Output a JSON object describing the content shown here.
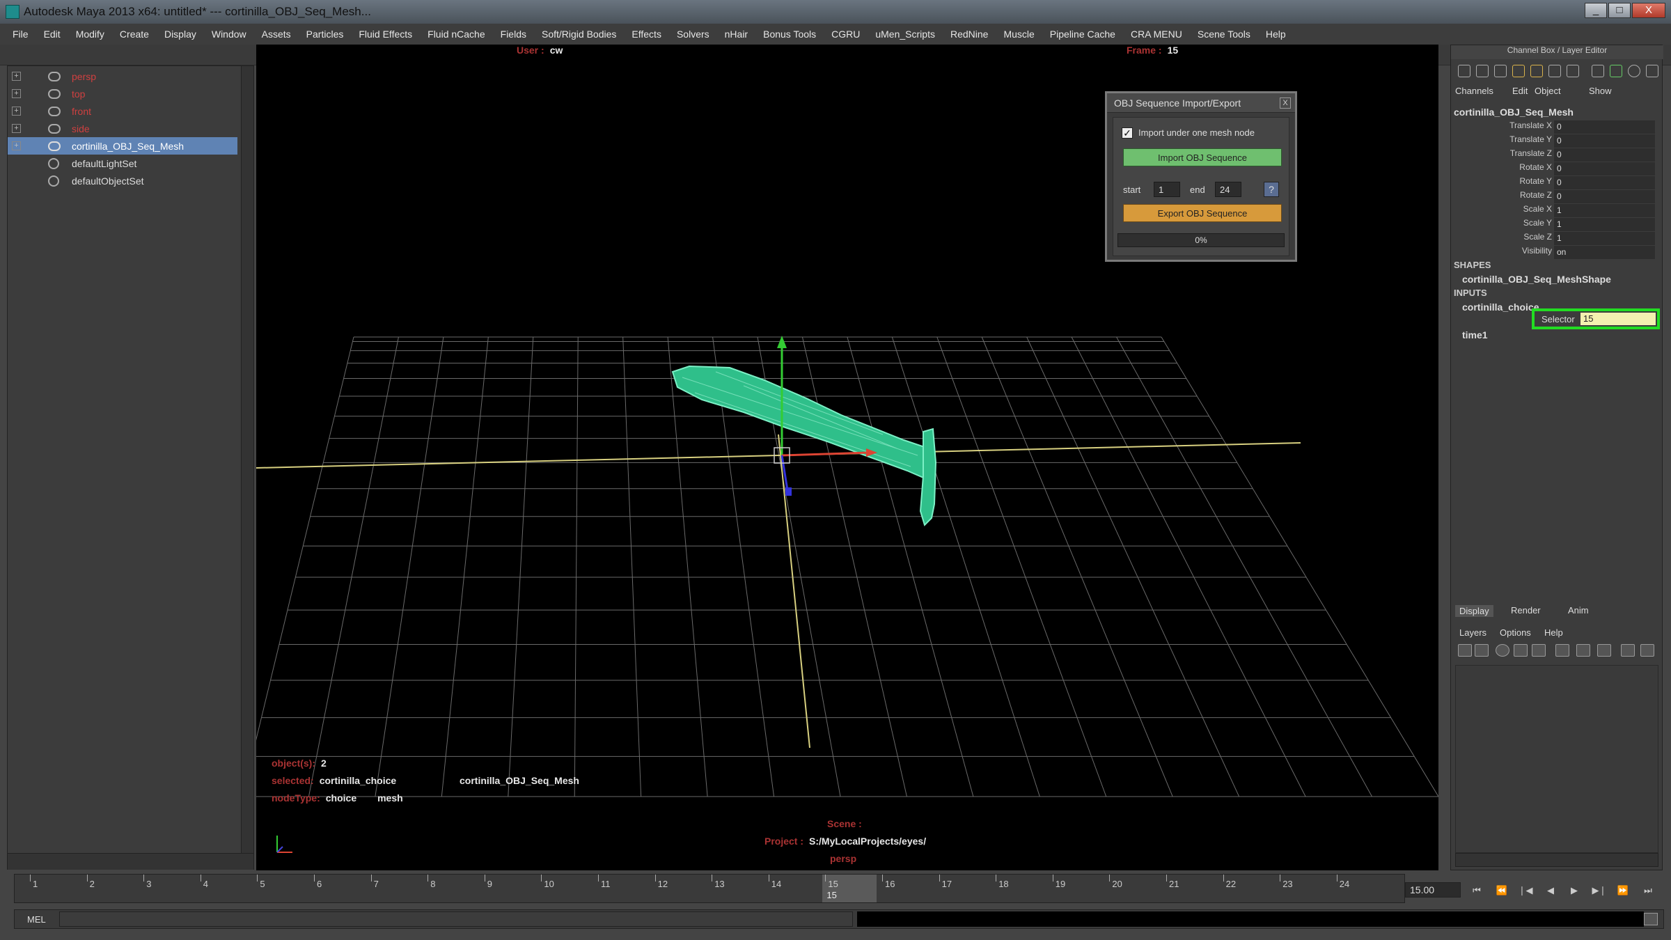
{
  "window": {
    "title": "Autodesk Maya 2013 x64: untitled*   ---   cortinilla_OBJ_Seq_Mesh...",
    "buttons": [
      "_",
      "□",
      "X"
    ]
  },
  "menubar": [
    "File",
    "Edit",
    "Modify",
    "Create",
    "Display",
    "Window",
    "Assets",
    "Particles",
    "Fluid Effects",
    "Fluid nCache",
    "Fields",
    "Soft/Rigid Bodies",
    "Effects",
    "Solvers",
    "nHair",
    "Bonus Tools",
    "CGRU",
    "uMen_Scripts",
    "RedNine",
    "Muscle",
    "Pipeline Cache",
    "CRA MENU",
    "Scene Tools",
    "Help"
  ],
  "outliner": {
    "items": [
      {
        "label": "persp",
        "type": "camera",
        "expand": "+"
      },
      {
        "label": "top",
        "type": "camera",
        "expand": "+"
      },
      {
        "label": "front",
        "type": "camera",
        "expand": "+"
      },
      {
        "label": "side",
        "type": "camera",
        "expand": "+"
      },
      {
        "label": "cortinilla_OBJ_Seq_Mesh",
        "type": "mesh",
        "expand": "+",
        "selected": true
      },
      {
        "label": "defaultLightSet",
        "type": "set",
        "expand": ""
      },
      {
        "label": "defaultObjectSet",
        "type": "set",
        "expand": ""
      }
    ]
  },
  "viewport": {
    "user_label": "User :",
    "user_value": "cw",
    "frame_label": "Frame :",
    "frame_value": "15",
    "objects_label": "object(s):",
    "objects_value": "2",
    "selected_label": "selected:",
    "selected_1": "cortinilla_choice",
    "selected_2": "cortinilla_OBJ_Seq_Mesh",
    "nodetype_label": "nodeType:",
    "nodetype_1": "choice",
    "nodetype_2": "mesh",
    "scene_label": "Scene :",
    "project_label": "Project :",
    "project_value": "S:/MyLocalProjects/eyes/",
    "camera": "persp"
  },
  "dialog": {
    "title": "OBJ Sequence Import/Export",
    "close": "X",
    "checkbox_label": "Import under one mesh node",
    "checkbox_checked": true,
    "import_button": "Import OBJ Sequence",
    "start_label": "start",
    "start_value": "1",
    "end_label": "end",
    "end_value": "24",
    "help": "?",
    "export_button": "Export OBJ Sequence",
    "progress_text": "0%",
    "progress_fraction": 0.0
  },
  "channel_box": {
    "header": "Channel Box / Layer Editor",
    "menu": [
      "Channels",
      "Edit",
      "Object",
      "Show"
    ],
    "object": "cortinilla_OBJ_Seq_Mesh",
    "channels": [
      {
        "name": "Translate X",
        "value": "0"
      },
      {
        "name": "Translate Y",
        "value": "0"
      },
      {
        "name": "Translate Z",
        "value": "0"
      },
      {
        "name": "Rotate X",
        "value": "0"
      },
      {
        "name": "Rotate Y",
        "value": "0"
      },
      {
        "name": "Rotate Z",
        "value": "0"
      },
      {
        "name": "Scale X",
        "value": "1"
      },
      {
        "name": "Scale Y",
        "value": "1"
      },
      {
        "name": "Scale Z",
        "value": "1"
      },
      {
        "name": "Visibility",
        "value": "on"
      }
    ],
    "shapes_label": "SHAPES",
    "shape": "cortinilla_OBJ_Seq_MeshShape",
    "inputs_label": "INPUTS",
    "input_1": "cortinilla_choice",
    "selector_label": "Selector",
    "selector_value": "15",
    "input_2": "time1"
  },
  "layer_editor": {
    "tabs": [
      "Display",
      "Render",
      "Anim"
    ],
    "menu": [
      "Layers",
      "Options",
      "Help"
    ]
  },
  "timeline": {
    "ticks": [
      "1",
      "2",
      "3",
      "4",
      "5",
      "6",
      "7",
      "8",
      "9",
      "10",
      "11",
      "12",
      "13",
      "14",
      "15",
      "16",
      "17",
      "18",
      "19",
      "20",
      "21",
      "22",
      "23",
      "24"
    ],
    "current": "15",
    "current_frame_field": "15.00"
  },
  "cmdline": {
    "label": "MEL"
  },
  "colors": {
    "accent_selection": "#5f83b4",
    "mesh": "#3fd6a0",
    "import_button": "#6fbf6f",
    "export_button": "#d79a3b",
    "highlight": "#22dd22"
  }
}
